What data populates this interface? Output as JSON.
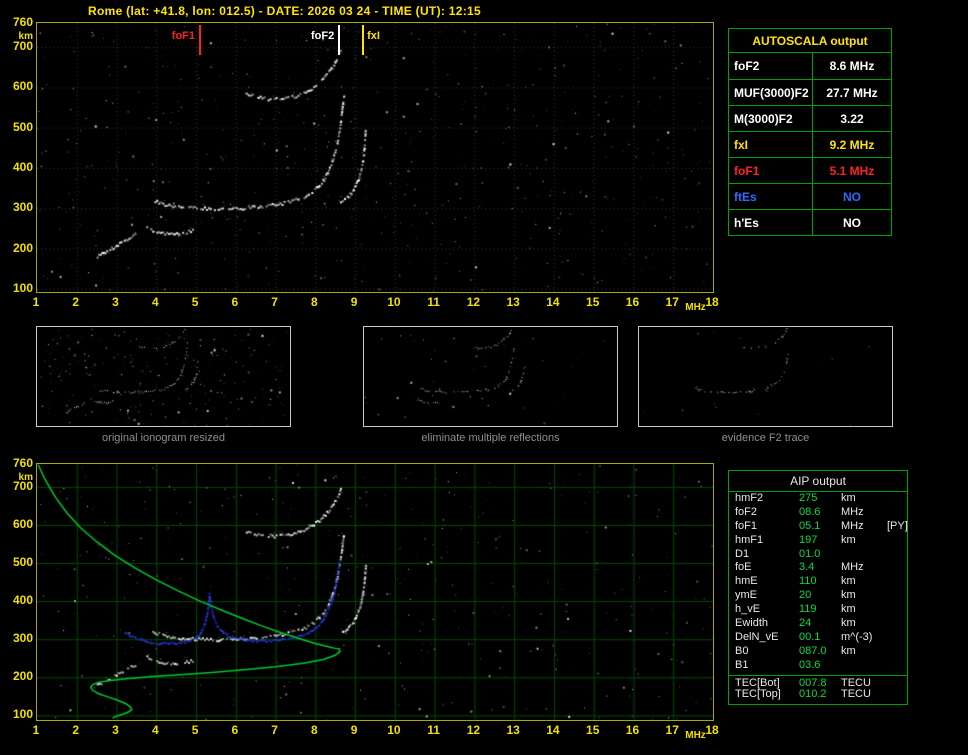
{
  "title": "Rome (lat: +41.8, lon: 012.5) - DATE: 2026 03 24 - TIME (UT): 12:15",
  "units": {
    "x": "MHz",
    "y": "km"
  },
  "colors": {
    "yellow": "#ffe400",
    "red": "#ff2222",
    "blue": "#2e6bff",
    "white": "#ffffff",
    "table_border_green": "#00a400",
    "grid_green": "#004c00",
    "profile_green": "#00c832",
    "value_green": "#00dd44",
    "caption_gray": "#8f8f8f",
    "trace_blue": "#2b3cf0"
  },
  "panels": [
    {
      "caption": "original ionogram resized"
    },
    {
      "caption": "eliminate multiple reflections"
    },
    {
      "caption": "evidence F2 trace"
    }
  ],
  "autoscala": {
    "header": "AUTOSCALA output",
    "rows": [
      {
        "label": "foF2",
        "value": "8.6 MHz",
        "color": "#ffffff"
      },
      {
        "label": "MUF(3000)F2",
        "value": "27.7 MHz",
        "color": "#ffffff"
      },
      {
        "label": "M(3000)F2",
        "value": "3.22",
        "color": "#ffffff"
      },
      {
        "label": "fxI",
        "value": "9.2 MHz",
        "color": "#ffe400"
      },
      {
        "label": "foF1",
        "value": "5.1 MHz",
        "color": "#ff2222"
      },
      {
        "label": "ftEs",
        "value": "NO",
        "color": "#2e6bff"
      },
      {
        "label": "h'Es",
        "value": "NO",
        "color": "#ffffff"
      }
    ]
  },
  "aip": {
    "header": "AIP output",
    "separator_index": 13,
    "rows": [
      {
        "label": "hmF2",
        "value": "275",
        "unit": "km",
        "extra": ""
      },
      {
        "label": "foF2",
        "value": "08.6",
        "unit": "MHz",
        "extra": ""
      },
      {
        "label": "foF1",
        "value": "05.1",
        "unit": "MHz",
        "extra": "[PY]"
      },
      {
        "label": "hmF1",
        "value": "197",
        "unit": "km",
        "extra": ""
      },
      {
        "label": "D1",
        "value": "01.0",
        "unit": "",
        "extra": ""
      },
      {
        "label": "foE",
        "value": "3.4",
        "unit": "MHz",
        "extra": ""
      },
      {
        "label": "hmE",
        "value": "110",
        "unit": "km",
        "extra": ""
      },
      {
        "label": "ymE",
        "value": "20",
        "unit": "km",
        "extra": ""
      },
      {
        "label": "h_vE",
        "value": "119",
        "unit": "km",
        "extra": ""
      },
      {
        "label": "Ewidth",
        "value": "24",
        "unit": "km",
        "extra": ""
      },
      {
        "label": "DelN_vE",
        "value": "00.1",
        "unit": "m^(-3)",
        "extra": ""
      },
      {
        "label": "B0",
        "value": "087.0",
        "unit": "km",
        "extra": ""
      },
      {
        "label": "B1",
        "value": "03.6",
        "unit": "",
        "extra": ""
      },
      {
        "label": "TEC[Bot]",
        "value": "007.8",
        "unit": "TECU",
        "extra": ""
      },
      {
        "label": "TEC[Top]",
        "value": "010.2",
        "unit": "TECU",
        "extra": ""
      }
    ]
  },
  "chart_data": [
    {
      "type": "scatter",
      "name": "ionogram",
      "title": "Rome ionogram 2026-03-24 12:15 UT",
      "xlabel": "MHz",
      "ylabel": "km",
      "x_range": [
        1,
        18
      ],
      "y_range": [
        90,
        760
      ],
      "xticks": [
        1,
        2,
        3,
        4,
        5,
        6,
        7,
        8,
        9,
        10,
        11,
        12,
        13,
        14,
        15,
        16,
        17,
        18
      ],
      "yticks": [
        760,
        700,
        600,
        500,
        400,
        300,
        200,
        100
      ],
      "grid": "dotted-faint",
      "markers": [
        {
          "label": "foF1",
          "freq": 5.1,
          "color": "#ff2222",
          "side": "left"
        },
        {
          "label": "foF2",
          "freq": 8.6,
          "color": "#ffffff",
          "side": "left"
        },
        {
          "label": "fxI",
          "freq": 9.2,
          "color": "#ffe400",
          "side": "right"
        }
      ],
      "series": [
        {
          "name": "F2-O-trace",
          "color": "#ffffff",
          "points": [
            [
              3.9,
              322
            ],
            [
              4.1,
              314
            ],
            [
              4.35,
              308
            ],
            [
              4.6,
              305
            ],
            [
              4.9,
              303
            ],
            [
              5.2,
              302
            ],
            [
              5.5,
              301
            ],
            [
              5.8,
              301
            ],
            [
              6.1,
              302
            ],
            [
              6.4,
              304
            ],
            [
              6.7,
              307
            ],
            [
              7.0,
              311
            ],
            [
              7.25,
              316
            ],
            [
              7.5,
              323
            ],
            [
              7.7,
              331
            ],
            [
              7.9,
              342
            ],
            [
              8.05,
              356
            ],
            [
              8.2,
              373
            ],
            [
              8.3,
              393
            ],
            [
              8.4,
              416
            ],
            [
              8.48,
              441
            ],
            [
              8.54,
              466
            ],
            [
              8.58,
              491
            ],
            [
              8.62,
              516
            ],
            [
              8.65,
              541
            ],
            [
              8.68,
              566
            ],
            [
              8.71,
              586
            ]
          ]
        },
        {
          "name": "F2-X-trace",
          "color": "#ffffff",
          "points": [
            [
              8.62,
              318
            ],
            [
              8.72,
              325
            ],
            [
              8.82,
              333
            ],
            [
              8.92,
              344
            ],
            [
              9.0,
              358
            ],
            [
              9.07,
              375
            ],
            [
              9.13,
              396
            ],
            [
              9.18,
              421
            ],
            [
              9.21,
              448
            ],
            [
              9.23,
              474
            ],
            [
              9.25,
              499
            ]
          ]
        },
        {
          "name": "F2-second-hop",
          "color": "#ffffff",
          "points": [
            [
              6.25,
              585
            ],
            [
              6.5,
              578
            ],
            [
              6.75,
              574
            ],
            [
              7.0,
              573
            ],
            [
              7.25,
              576
            ],
            [
              7.5,
              581
            ],
            [
              7.7,
              589
            ],
            [
              7.9,
              600
            ],
            [
              8.08,
              613
            ],
            [
              8.24,
              629
            ],
            [
              8.38,
              647
            ],
            [
              8.5,
              667
            ],
            [
              8.58,
              686
            ],
            [
              8.64,
              700
            ]
          ]
        },
        {
          "name": "Es-fragment",
          "color": "#ffffff",
          "points": [
            [
              2.5,
              182
            ],
            [
              2.7,
              193
            ],
            [
              2.9,
              204
            ],
            [
              3.1,
              216
            ],
            [
              3.3,
              228
            ],
            [
              3.5,
              238
            ]
          ]
        },
        {
          "name": "F1-fragment",
          "color": "#ffffff",
          "points": [
            [
              3.75,
              254
            ],
            [
              3.95,
              246
            ],
            [
              4.15,
              240
            ],
            [
              4.35,
              237
            ],
            [
              4.55,
              238
            ],
            [
              4.75,
              242
            ],
            [
              4.95,
              248
            ]
          ]
        }
      ]
    },
    {
      "type": "scatter+line",
      "name": "ionogram-with-profile",
      "xlabel": "MHz",
      "ylabel": "km",
      "x_range": [
        1,
        18
      ],
      "y_range": [
        88,
        760
      ],
      "grid": "solid-green",
      "series": [
        {
          "name": "restored-F2-trace",
          "color": "#2b3cf0",
          "points": [
            [
              3.2,
              318
            ],
            [
              3.45,
              306
            ],
            [
              3.7,
              297
            ],
            [
              3.95,
              292
            ],
            [
              4.2,
              290
            ],
            [
              4.45,
              291
            ],
            [
              4.7,
              295
            ],
            [
              4.9,
              302
            ],
            [
              5.05,
              312
            ],
            [
              5.15,
              328
            ],
            [
              5.22,
              350
            ],
            [
              5.27,
              375
            ],
            [
              5.3,
              400
            ],
            [
              5.32,
              420
            ],
            [
              5.36,
              388
            ],
            [
              5.42,
              360
            ],
            [
              5.5,
              338
            ],
            [
              5.62,
              322
            ],
            [
              5.8,
              311
            ],
            [
              6.0,
              304
            ],
            [
              6.25,
              300
            ],
            [
              6.5,
              298
            ],
            [
              6.75,
              298
            ],
            [
              7.0,
              300
            ],
            [
              7.25,
              303
            ],
            [
              7.5,
              308
            ],
            [
              7.7,
              315
            ],
            [
              7.9,
              325
            ],
            [
              8.05,
              338
            ],
            [
              8.2,
              356
            ],
            [
              8.3,
              378
            ],
            [
              8.4,
              405
            ],
            [
              8.47,
              432
            ],
            [
              8.52,
              458
            ],
            [
              8.56,
              485
            ],
            [
              8.59,
              510
            ]
          ]
        },
        {
          "name": "electron-density-profile",
          "color": "#00c832",
          "style": "line",
          "points": [
            [
              1.03,
              758
            ],
            [
              1.2,
              720
            ],
            [
              1.45,
              675
            ],
            [
              1.75,
              632
            ],
            [
              2.1,
              592
            ],
            [
              2.5,
              556
            ],
            [
              2.95,
              521
            ],
            [
              3.45,
              488
            ],
            [
              4.0,
              456
            ],
            [
              4.55,
              427
            ],
            [
              5.1,
              400
            ],
            [
              5.65,
              376
            ],
            [
              6.2,
              353
            ],
            [
              6.7,
              333
            ],
            [
              7.2,
              315
            ],
            [
              7.65,
              300
            ],
            [
              8.0,
              289
            ],
            [
              8.3,
              281
            ],
            [
              8.5,
              276
            ],
            [
              8.6,
              275
            ],
            [
              8.62,
              268
            ],
            [
              8.5,
              258
            ],
            [
              8.2,
              247
            ],
            [
              7.7,
              237
            ],
            [
              7.0,
              228
            ],
            [
              6.2,
              220
            ],
            [
              5.4,
              213
            ],
            [
              4.6,
              207
            ],
            [
              3.9,
              202
            ],
            [
              3.3,
              197
            ],
            [
              2.85,
              192
            ],
            [
              2.55,
              187
            ],
            [
              2.4,
              181
            ],
            [
              2.35,
              174
            ],
            [
              2.4,
              166
            ],
            [
              2.55,
              157
            ],
            [
              2.8,
              148
            ],
            [
              3.05,
              139
            ],
            [
              3.25,
              130
            ],
            [
              3.35,
              122
            ],
            [
              3.38,
              115
            ],
            [
              3.3,
              109
            ],
            [
              3.15,
              103
            ],
            [
              3.0,
              98
            ],
            [
              2.9,
              93
            ]
          ]
        }
      ]
    }
  ]
}
